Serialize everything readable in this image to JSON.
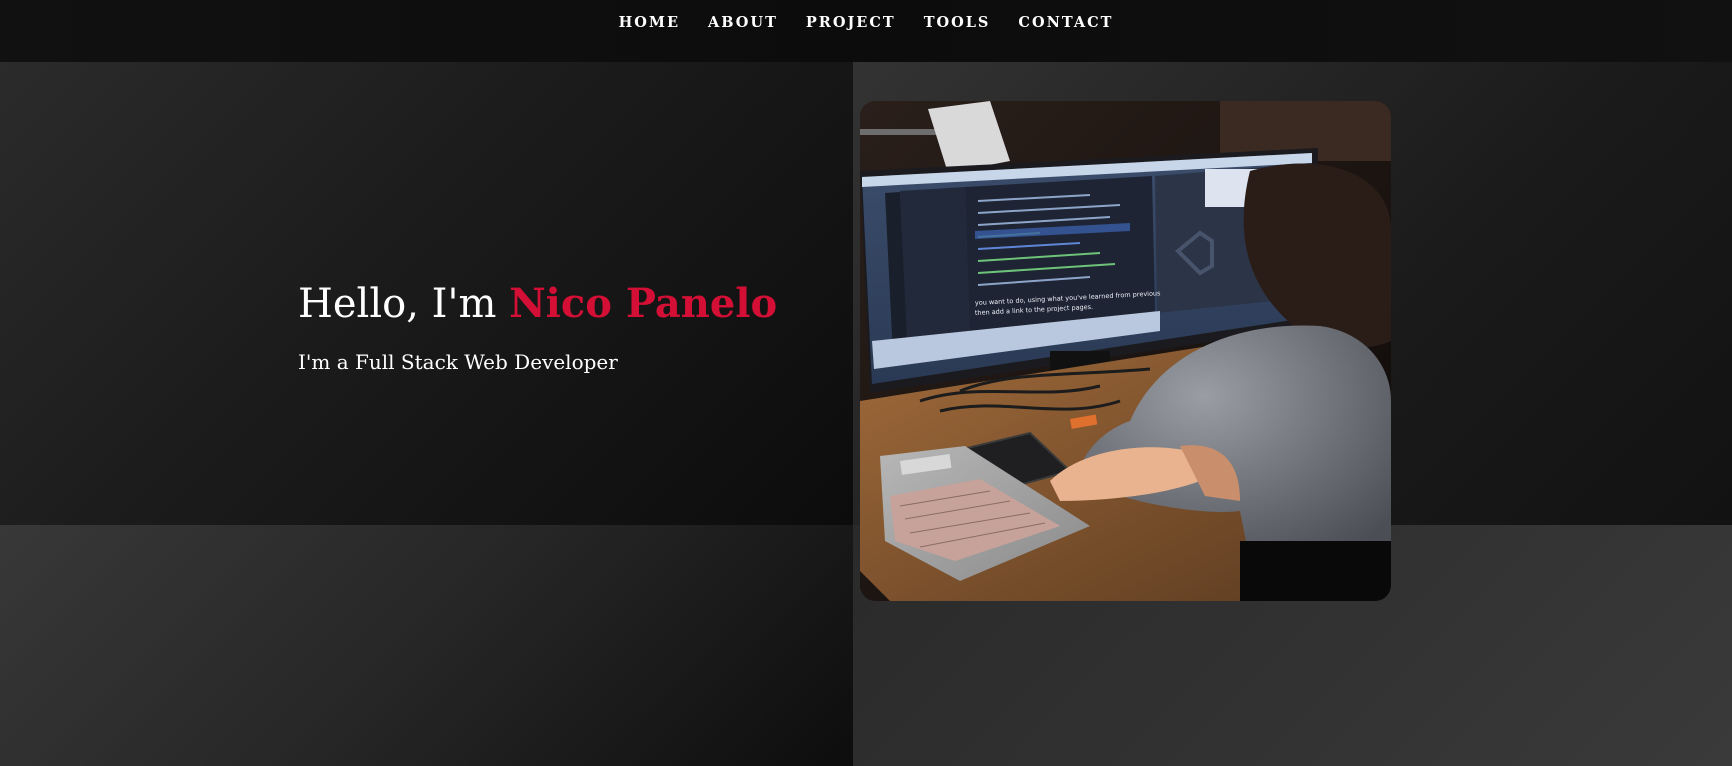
{
  "nav": {
    "items": [
      {
        "label": "HOME"
      },
      {
        "label": "ABOUT"
      },
      {
        "label": "PROJECT"
      },
      {
        "label": "TOOLS"
      },
      {
        "label": "CONTACT"
      }
    ]
  },
  "hero": {
    "greeting": "Hello, I'm",
    "name": "Nico Panelo",
    "subtitle": "I'm a Full Stack Web Developer"
  },
  "photo": {
    "screen_caption_line1": "you want to do, using what you've learned from previous",
    "screen_caption_line2": "then add a link to the project pages."
  },
  "colors": {
    "accent": "#d40f35",
    "text": "#ffffff",
    "nav_bg": "#0c0c0c"
  }
}
